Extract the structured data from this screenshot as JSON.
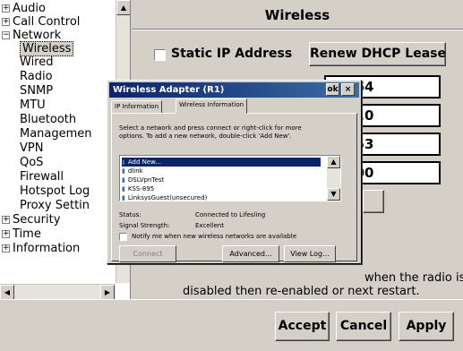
{
  "tree": {
    "items": [
      {
        "label": "Audio",
        "expander": "+"
      },
      {
        "label": "Call Control",
        "expander": "+"
      },
      {
        "label": "Network",
        "expander": "−"
      },
      {
        "label": "Wireless",
        "selected": true
      },
      {
        "label": "Wired"
      },
      {
        "label": "Radio"
      },
      {
        "label": "SNMP"
      },
      {
        "label": "MTU"
      },
      {
        "label": "Bluetooth"
      },
      {
        "label": "Managemen"
      },
      {
        "label": "VPN"
      },
      {
        "label": "QoS"
      },
      {
        "label": "Firewall"
      },
      {
        "label": "Hotspot Log"
      },
      {
        "label": "Proxy Settin"
      },
      {
        "label": "Security",
        "expander": "+"
      },
      {
        "label": "Time",
        "expander": "+"
      },
      {
        "label": "Information",
        "expander": "+"
      }
    ]
  },
  "main": {
    "title": "Wireless",
    "static_ip_label": "Static IP Address",
    "renew_button": "Renew DHCP Lease",
    "ip_fields": [
      "1.164",
      "255.0",
      "1.253",
      "1.200"
    ],
    "note_line1": "when the radio is",
    "note_line2": "disabled then re-enabled or next restart."
  },
  "dialog": {
    "title": "Wireless Adapter (R1)",
    "ok_label": "ok",
    "close_label": "×",
    "tabs": [
      "IP Information",
      "Wireless Information"
    ],
    "instructions_line1": "Select a network and press connect or right-click for more",
    "instructions_line2": "options.  To add a new network, double-click 'Add New'.",
    "networks": [
      "Add New...",
      "dlink",
      "DSLVpnTest",
      "KSS-895",
      "LinksysGuest(unsecured)"
    ],
    "status_label": "Status:",
    "status_value": "Connected to Lifesling",
    "signal_label": "Signal Strength:",
    "signal_value": "Excellent",
    "notify_label": "Notify me when new wireless networks are available",
    "connect_button": "Connect",
    "advanced_button": "Advanced...",
    "viewlog_button": "View Log..."
  },
  "bottom": {
    "accept_button": "Accept",
    "cancel_button": "Cancel",
    "apply_button": "Apply"
  }
}
